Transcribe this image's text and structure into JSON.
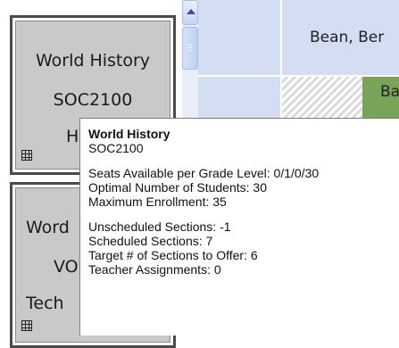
{
  "course_cards": [
    {
      "lines": [
        "World History",
        "SOC2100",
        "Hi"
      ]
    },
    {
      "lines": [
        "Word",
        "VO",
        "Tech"
      ]
    }
  ],
  "icons": {
    "card_grid": "grid-icon"
  },
  "scrollbar": {
    "up_arrow": "scroll-up-arrow"
  },
  "schedule": {
    "teacher_name": "Bean, Ber",
    "section_label": "Ba",
    "colors": {
      "cell": "#d4def2",
      "assigned": "#7aa35a"
    }
  },
  "tooltip": {
    "title": "World History",
    "code": "SOC2100",
    "group1": [
      "Seats Available per Grade Level: 0/1/0/30",
      "Optimal Number of Students: 30",
      "Maximum Enrollment: 35"
    ],
    "group2": [
      "Unscheduled Sections: -1",
      "Scheduled Sections: 7",
      "Target # of Sections to Offer: 6",
      "Teacher Assignments: 0"
    ]
  }
}
